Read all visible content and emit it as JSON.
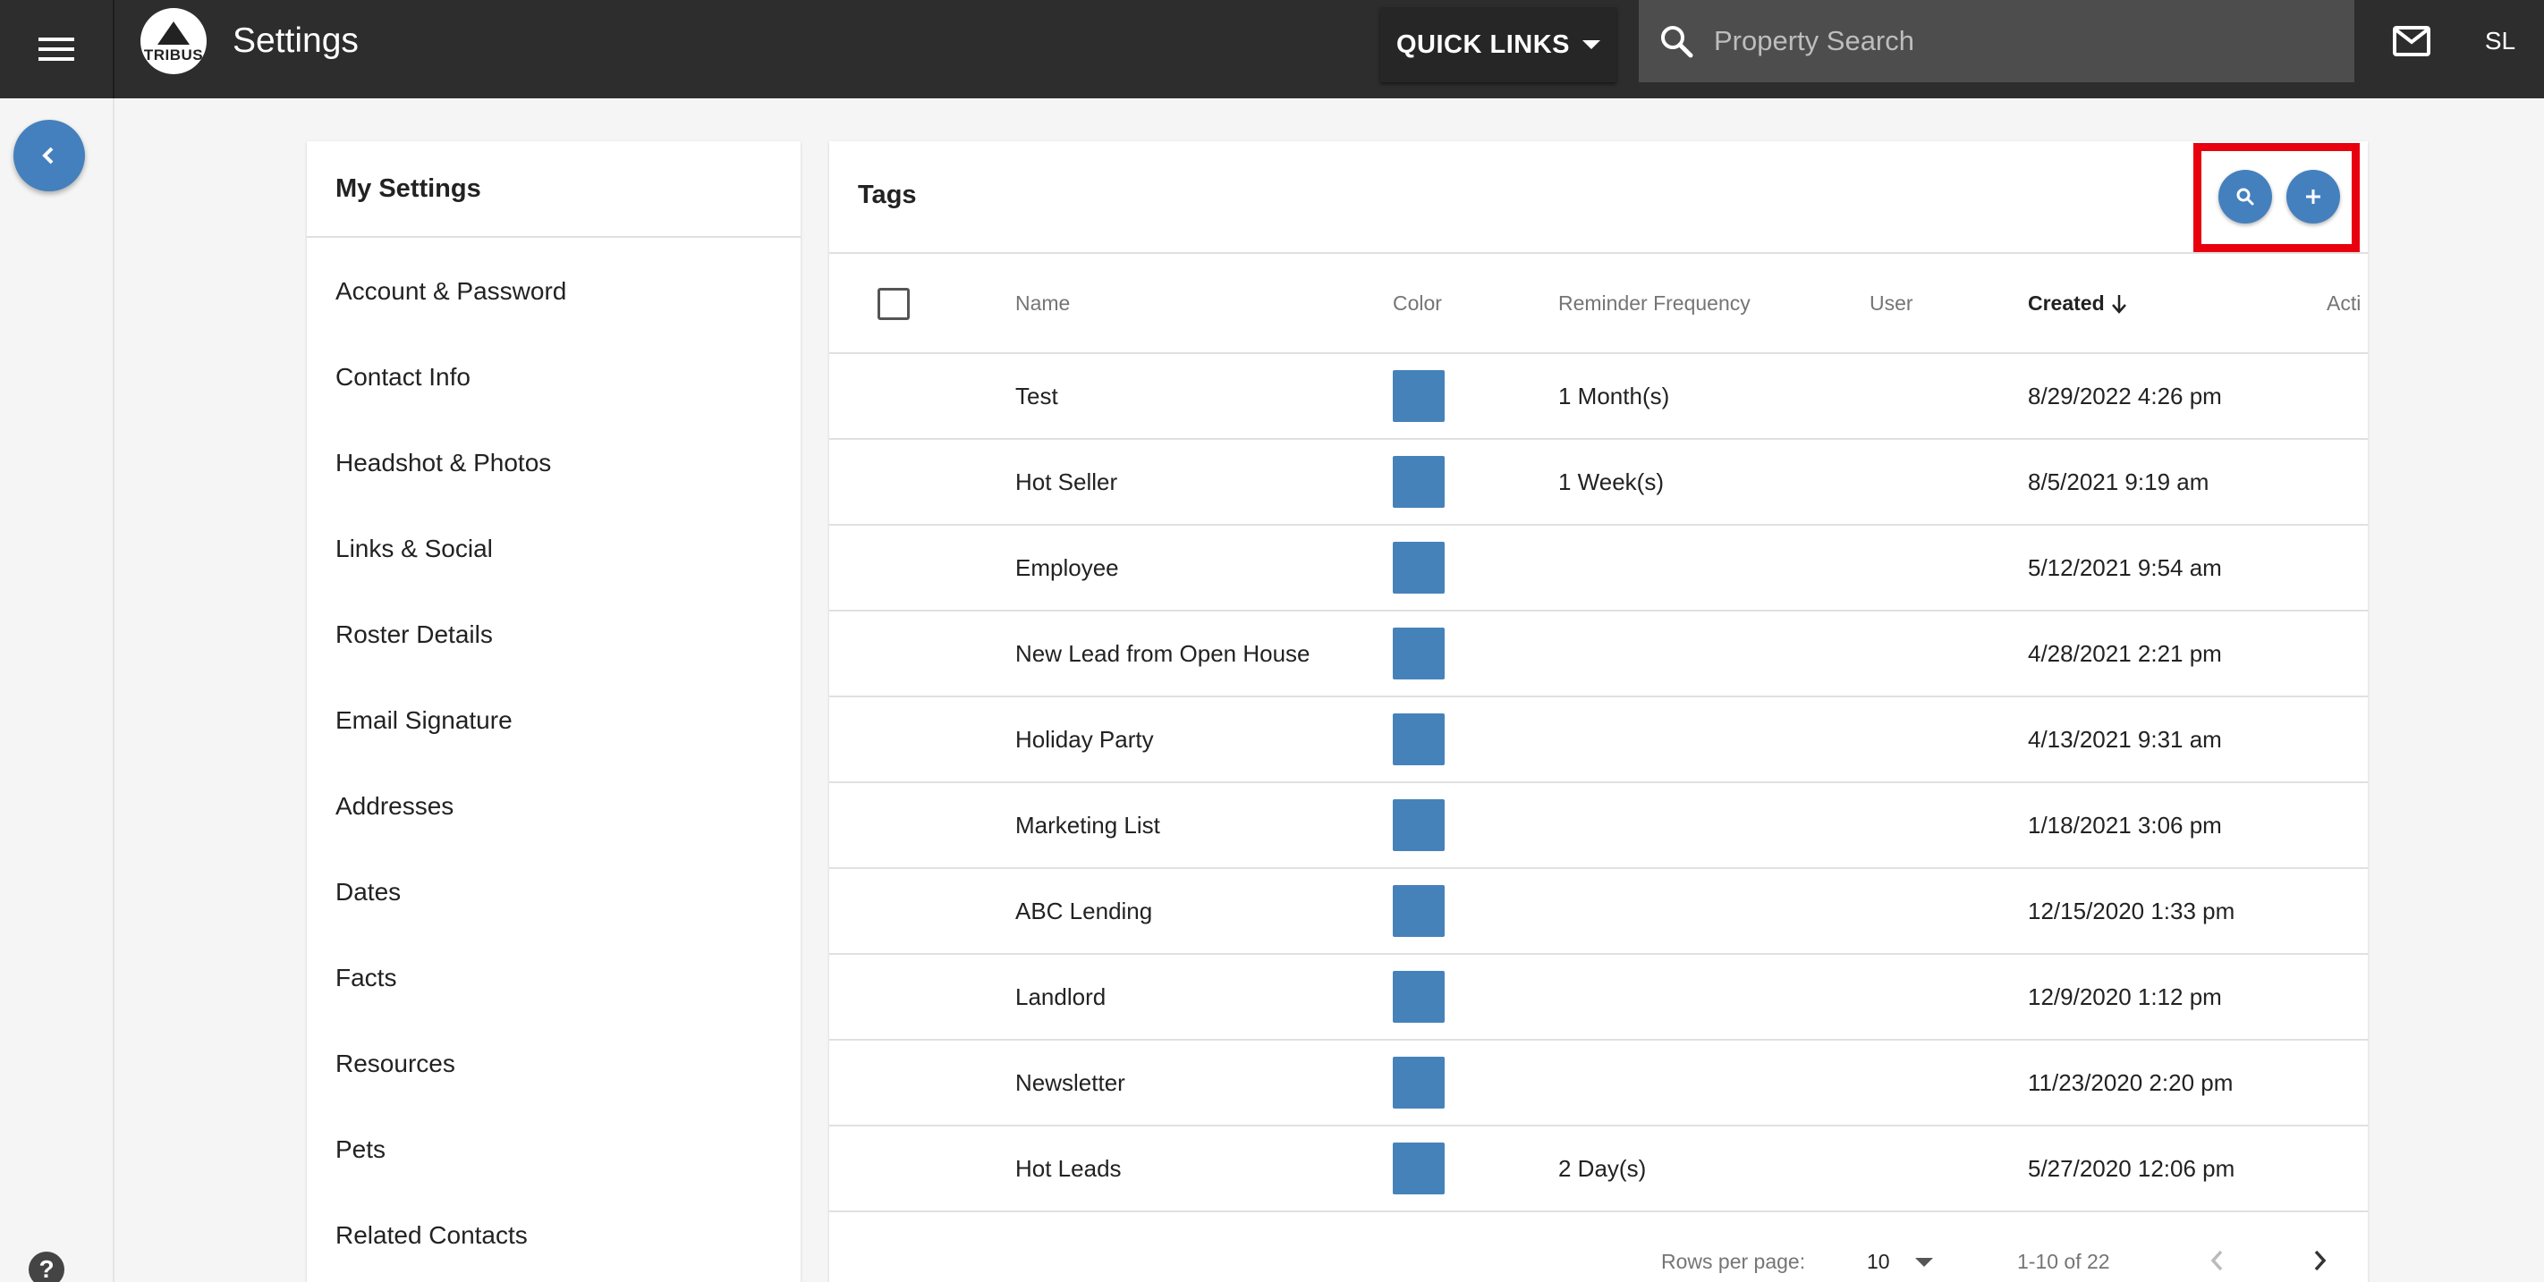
{
  "header": {
    "app_title": "Settings",
    "logo_text": "TRIBUS",
    "quick_links_label": "QUICK LINKS",
    "search_placeholder": "Property Search",
    "avatar_initials": "SL"
  },
  "settings_nav": {
    "heading": "My Settings",
    "items": [
      "Account & Password",
      "Contact Info",
      "Headshot & Photos",
      "Links & Social",
      "Roster Details",
      "Email Signature",
      "Addresses",
      "Dates",
      "Facts",
      "Resources",
      "Pets",
      "Related Contacts"
    ]
  },
  "tags": {
    "title": "Tags",
    "columns": {
      "name": "Name",
      "color": "Color",
      "reminder": "Reminder Frequency",
      "user": "User",
      "created": "Created",
      "actions": "Acti"
    },
    "rows": [
      {
        "name": "Test",
        "color": "#4682ba",
        "reminder": "1 Month(s)",
        "user": "",
        "created": "8/29/2022 4:26 pm"
      },
      {
        "name": "Hot Seller",
        "color": "#4682ba",
        "reminder": "1 Week(s)",
        "user": "",
        "created": "8/5/2021 9:19 am"
      },
      {
        "name": "Employee",
        "color": "#4682ba",
        "reminder": "",
        "user": "",
        "created": "5/12/2021 9:54 am"
      },
      {
        "name": "New Lead from Open House",
        "color": "#4682ba",
        "reminder": "",
        "user": "",
        "created": "4/28/2021 2:21 pm"
      },
      {
        "name": "Holiday Party",
        "color": "#4682ba",
        "reminder": "",
        "user": "",
        "created": "4/13/2021 9:31 am"
      },
      {
        "name": "Marketing List",
        "color": "#4682ba",
        "reminder": "",
        "user": "",
        "created": "1/18/2021 3:06 pm"
      },
      {
        "name": "ABC Lending",
        "color": "#4682ba",
        "reminder": "",
        "user": "",
        "created": "12/15/2020 1:33 pm"
      },
      {
        "name": "Landlord",
        "color": "#4682ba",
        "reminder": "",
        "user": "",
        "created": "12/9/2020 1:12 pm"
      },
      {
        "name": "Newsletter",
        "color": "#4682ba",
        "reminder": "",
        "user": "",
        "created": "11/23/2020 2:20 pm"
      },
      {
        "name": "Hot Leads",
        "color": "#4682ba",
        "reminder": "2 Day(s)",
        "user": "",
        "created": "5/27/2020 12:06 pm"
      }
    ],
    "pagination": {
      "rows_per_page_label": "Rows per page:",
      "rows_per_page_value": "10",
      "range": "1-10 of 22"
    }
  },
  "colors": {
    "topbar": "#2d2d2d",
    "accent": "#4480bd",
    "highlight": "#e8000f"
  }
}
